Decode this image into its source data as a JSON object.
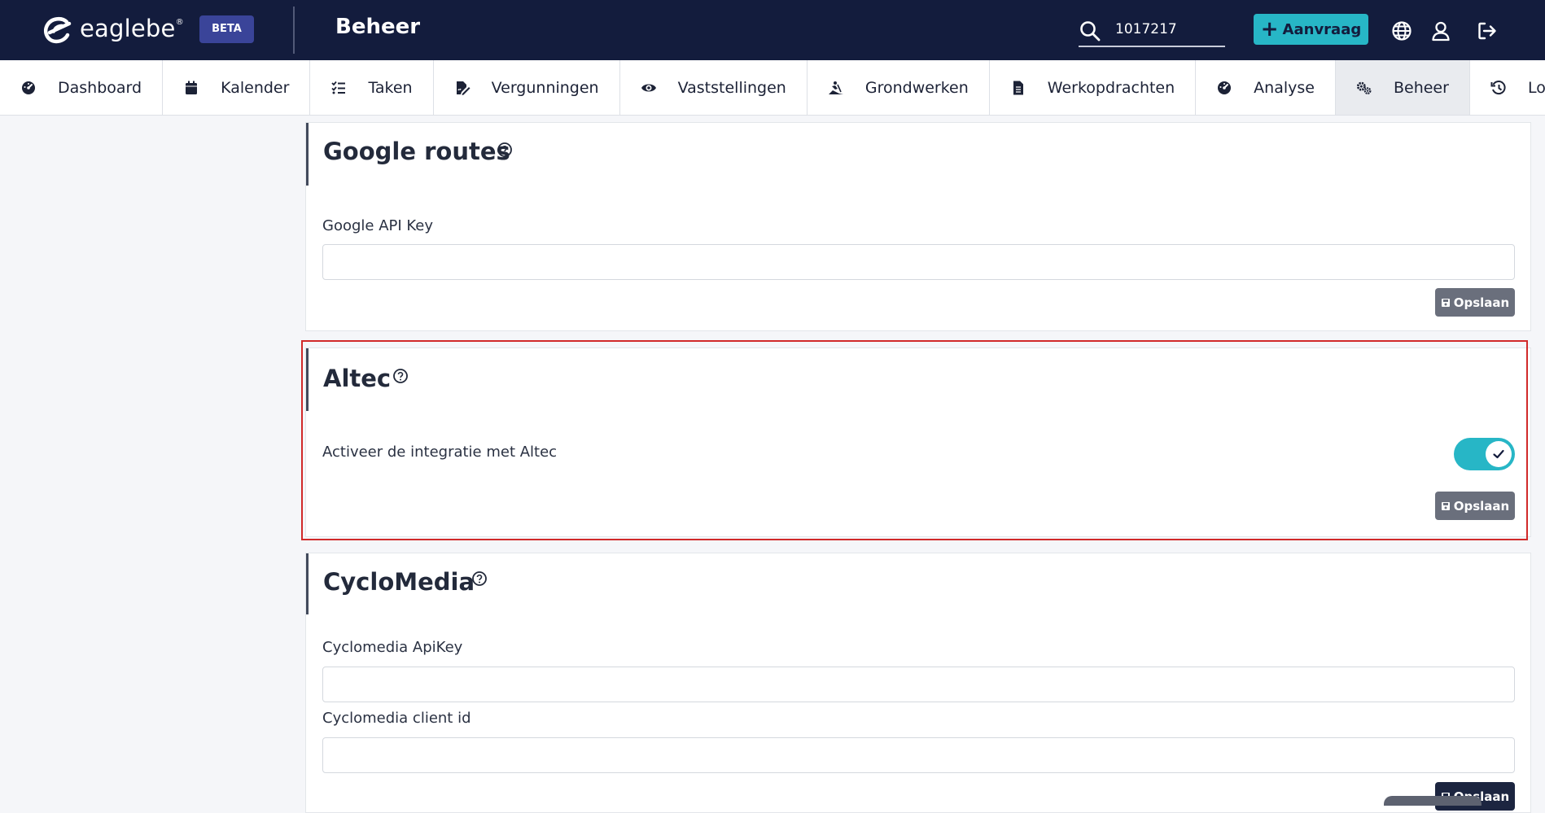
{
  "app": {
    "brand": "eaglebe",
    "brand_mark": "®",
    "badge": "BETA",
    "page_title": "Beheer"
  },
  "header": {
    "search_value": "1017217",
    "new_request_label": "Aanvraag",
    "icons": [
      "search-icon",
      "globe-icon",
      "user-icon",
      "logout-icon"
    ],
    "accent_color": "#27b6c6",
    "bar_color": "#131c3d"
  },
  "nav": {
    "items": [
      {
        "label": "Dashboard",
        "icon": "dashboard-icon"
      },
      {
        "label": "Kalender",
        "icon": "calendar-icon"
      },
      {
        "label": "Taken",
        "icon": "tasks-icon"
      },
      {
        "label": "Vergunningen",
        "icon": "permit-icon"
      },
      {
        "label": "Vaststellingen",
        "icon": "eye-icon"
      },
      {
        "label": "Grondwerken",
        "icon": "digging-icon"
      },
      {
        "label": "Werkopdrachten",
        "icon": "document-icon"
      },
      {
        "label": "Analyse",
        "icon": "analysis-icon"
      },
      {
        "label": "Beheer",
        "icon": "gears-icon",
        "active": true
      },
      {
        "label": "Logs",
        "icon": "history-icon"
      }
    ]
  },
  "sections": {
    "google": {
      "title": "Google routes",
      "api_key_label": "Google API Key",
      "api_key_value": "",
      "save_label": "Opslaan"
    },
    "altec": {
      "title": "Altec",
      "toggle_label": "Activeer de integratie met Altec",
      "toggle_on": true,
      "save_label": "Opslaan"
    },
    "cyclomedia": {
      "title": "CycloMedia",
      "api_key_label": "Cyclomedia ApiKey",
      "api_key_value": "",
      "client_id_label": "Cyclomedia client id",
      "client_id_value": "",
      "save_label": "Opslaan"
    }
  },
  "highlight_color": "#d12a2a"
}
